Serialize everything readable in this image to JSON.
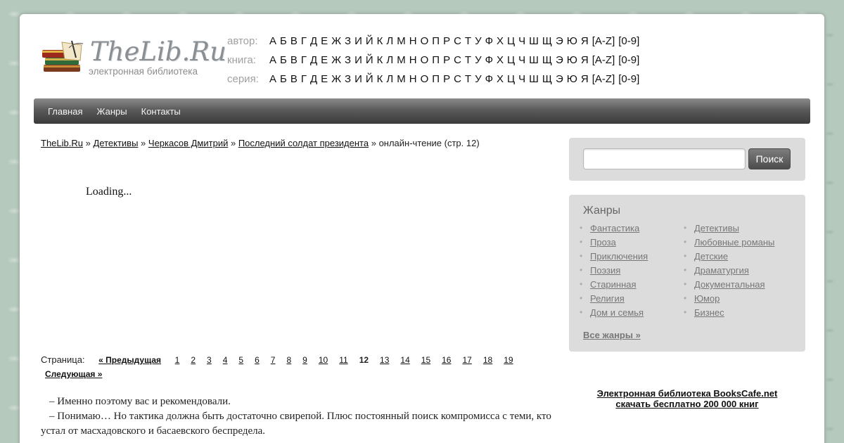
{
  "logo": {
    "title": "TheLib.Ru",
    "subtitle": "электронная библиотека"
  },
  "alphabet": {
    "rows": [
      {
        "label": "автор:",
        "letters": [
          "А",
          "Б",
          "В",
          "Г",
          "Д",
          "Е",
          "Ж",
          "З",
          "И",
          "Й",
          "К",
          "Л",
          "М",
          "Н",
          "О",
          "П",
          "Р",
          "С",
          "Т",
          "У",
          "Ф",
          "Х",
          "Ц",
          "Ч",
          "Ш",
          "Щ",
          "Э",
          "Ю",
          "Я",
          "[A-Z]",
          "[0-9]"
        ]
      },
      {
        "label": "книга:",
        "letters": [
          "А",
          "Б",
          "В",
          "Г",
          "Д",
          "Е",
          "Ж",
          "З",
          "И",
          "Й",
          "К",
          "Л",
          "М",
          "Н",
          "О",
          "П",
          "Р",
          "С",
          "Т",
          "У",
          "Ф",
          "Х",
          "Ц",
          "Ч",
          "Ш",
          "Щ",
          "Э",
          "Ю",
          "Я",
          "[A-Z]",
          "[0-9]"
        ]
      },
      {
        "label": "серия:",
        "letters": [
          "А",
          "Б",
          "В",
          "Г",
          "Д",
          "Е",
          "Ж",
          "З",
          "И",
          "Й",
          "К",
          "Л",
          "М",
          "Н",
          "О",
          "П",
          "Р",
          "С",
          "Т",
          "У",
          "Ф",
          "Х",
          "Ц",
          "Ч",
          "Ш",
          "Щ",
          "Э",
          "Ю",
          "Я",
          "[A-Z]",
          "[0-9]"
        ]
      }
    ]
  },
  "nav": {
    "items": [
      "Главная",
      "Жанры",
      "Контакты"
    ]
  },
  "breadcrumb": {
    "links": [
      "TheLib.Ru",
      "Детективы",
      "Черкасов Дмитрий",
      "Последний солдат президента"
    ],
    "separator": "»",
    "current": "онлайн-чтение (стр. 12)"
  },
  "loading": "Loading...",
  "pager": {
    "label": "Страница:",
    "prev": "« Предыдущая",
    "pages": [
      "1",
      "2",
      "3",
      "4",
      "5",
      "6",
      "7",
      "8",
      "9",
      "10",
      "11",
      "12",
      "13",
      "14",
      "15",
      "16",
      "17",
      "18",
      "19"
    ],
    "current": "12",
    "next": "Следующая »"
  },
  "text": {
    "paragraphs": [
      "– Именно поэтому вас и рекомендовали.",
      "– Понимаю… Но тактика должна быть достаточно свирепой. Плюс постоянный поиск компромисса с теми, кто устал от масхадовского и басаевского беспредела."
    ]
  },
  "search": {
    "placeholder": "",
    "button": "Поиск"
  },
  "genres": {
    "title": "Жанры",
    "col1": [
      "Фантастика",
      "Проза",
      "Приключения",
      "Поэзия",
      "Старинная",
      "Религия",
      "Дом и семья"
    ],
    "col2": [
      "Детективы",
      "Любовные романы",
      "Детские",
      "Драматургия",
      "Документальная",
      "Юмор",
      "Бизнес"
    ],
    "all": "Все жанры »"
  },
  "promo": {
    "line1": "Электронная библиотека BooksCafe.net",
    "line2": "скачать бесплатно 200 000 книг"
  }
}
